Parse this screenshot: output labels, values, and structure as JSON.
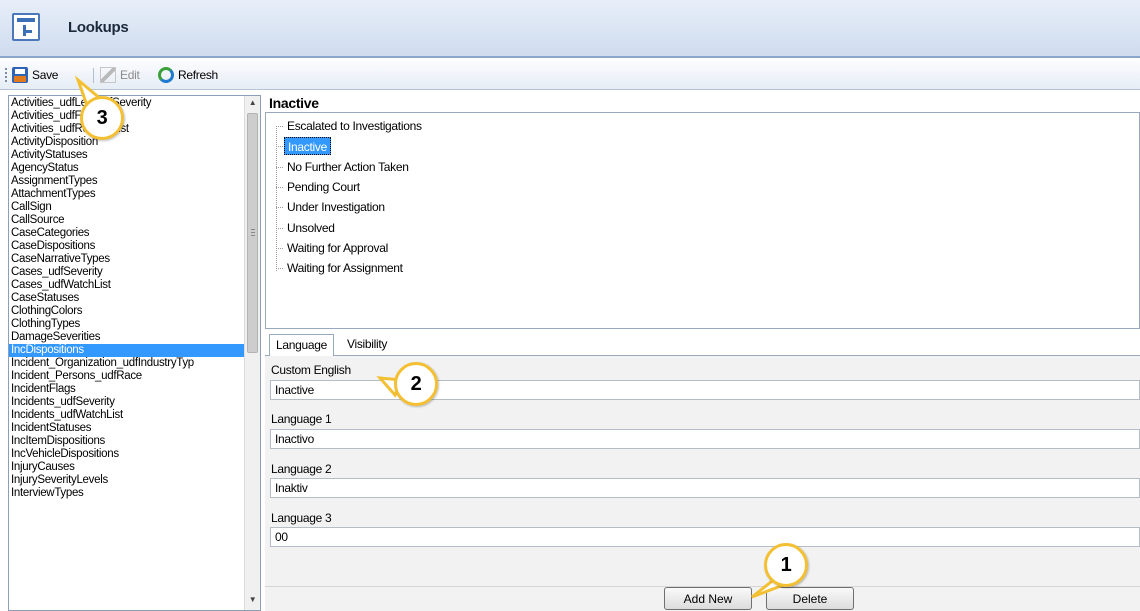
{
  "window": {
    "title": "Lookups"
  },
  "toolbar": {
    "save_label": "Save",
    "edit_label": "Edit",
    "refresh_label": "Refresh"
  },
  "lookups": {
    "items": [
      "Activities_udfLevelOfSeverity",
      "Activities_udfField2",
      "Activities_udfRelatedList",
      "ActivityDisposition",
      "ActivityStatuses",
      "AgencyStatus",
      "AssignmentTypes",
      "AttachmentTypes",
      "CallSign",
      "CallSource",
      "CaseCategories",
      "CaseDispositions",
      "CaseNarrativeTypes",
      "Cases_udfSeverity",
      "Cases_udfWatchList",
      "CaseStatuses",
      "ClothingColors",
      "ClothingTypes",
      "DamageSeverities",
      "IncDispositions",
      "Incident_Organization_udfIndustryTyp",
      "Incident_Persons_udfRace",
      "IncidentFlags",
      "Incidents_udfSeverity",
      "Incidents_udfWatchList",
      "IncidentStatuses",
      "IncItemDispositions",
      "IncVehicleDispositions",
      "InjuryCauses",
      "InjurySeverityLevels",
      "InterviewTypes"
    ],
    "selected": "IncDispositions"
  },
  "detail": {
    "heading": "Inactive",
    "tree_items": [
      "Escalated to Investigations",
      "Inactive",
      "No Further Action Taken",
      "Pending Court",
      "Under Investigation",
      "Unsolved",
      "Waiting for Approval",
      "Waiting for Assignment"
    ],
    "selected_tree_item": "Inactive"
  },
  "tabs": {
    "language": "Language",
    "visibility": "Visibility"
  },
  "form": {
    "custom_english_label": "Custom English",
    "custom_english_value": "Inactive",
    "language1_label": "Language 1",
    "language1_value": "Inactivo",
    "language2_label": "Language 2",
    "language2_value": "Inaktiv",
    "language3_label": "Language 3",
    "language3_value": "00"
  },
  "buttons": {
    "add_new": "Add New",
    "delete": "Delete"
  },
  "callouts": {
    "one": "1",
    "two": "2",
    "three": "3"
  }
}
